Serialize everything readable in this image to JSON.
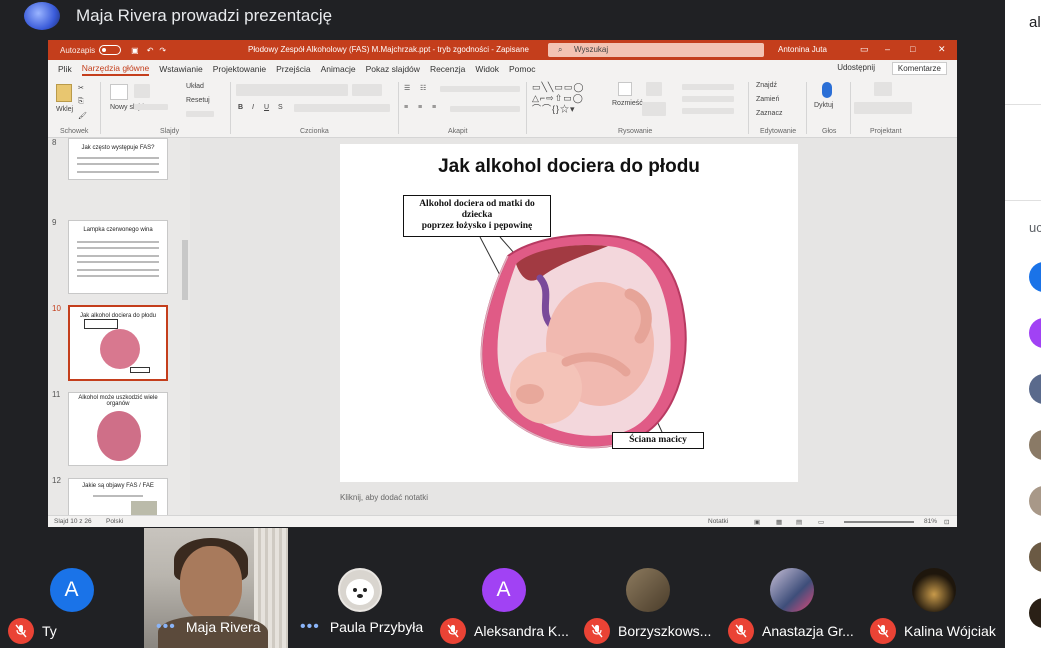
{
  "meet": {
    "presenter_title": "Maja Rivera prowadzi prezentację",
    "sidepanel": {
      "top_fragment": "al",
      "label_fragment": "uc"
    }
  },
  "ppt": {
    "autosave_label": "Autozapis",
    "filename": "Płodowy Zespół Alkoholowy (FAS) M.Majchrzak.ppt  -  tryb zgodności  -  Zapisane",
    "search_placeholder": "Wyszukaj",
    "user": "Antonina Juta",
    "menu": [
      "Plik",
      "Narzędzia główne",
      "Wstawianie",
      "Projektowanie",
      "Przejścia",
      "Animacje",
      "Pokaz slajdów",
      "Recenzja",
      "Widok",
      "Pomoc"
    ],
    "active_menu": "Narzędzia główne",
    "share_label": "Udostępnij",
    "comments_label": "Komentarze",
    "ribbon": {
      "paste": "Wklej",
      "new_slide": "Nowy slajd",
      "layout": "Układ",
      "reset": "Resetuj",
      "arrange": "Rozmieść",
      "find": "Znajdź",
      "replace": "Zamień",
      "select": "Zaznacz",
      "dictate": "Dyktuj",
      "groups": [
        "Schowek",
        "Slajdy",
        "Czcionka",
        "Akapit",
        "Rysowanie",
        "Edytowanie",
        "Głos",
        "Projektant"
      ]
    },
    "thumbnails": [
      {
        "num": "8",
        "title": "Jak często występuje FAS?"
      },
      {
        "num": "9",
        "title": "Lampka czerwonego wina"
      },
      {
        "num": "10",
        "title": "Jak alkohol dociera do płodu"
      },
      {
        "num": "11",
        "title": "Alkohol może uszkodzić wiele organów"
      },
      {
        "num": "12",
        "title": "Jakie są objawy FAS / FAE"
      }
    ],
    "slide": {
      "title": "Jak alkohol dociera do płodu",
      "callout_top": [
        "Alkohol dociera od matki do",
        "dziecka",
        "poprzez łożysko i pępowinę"
      ],
      "callout_bottom": "Ściana macicy"
    },
    "notes_placeholder": "Kliknij, aby dodać notatki",
    "status": {
      "slide_counter": "Slajd 10 z 26",
      "language": "Polski",
      "notes": "Notatki",
      "zoom": "81%"
    }
  },
  "participants": [
    {
      "name": "Ty",
      "initial": "",
      "color": "",
      "muted": true
    },
    {
      "name": "Maja Rivera",
      "initial": "",
      "color": "",
      "muted": false,
      "video": true
    },
    {
      "name": "Paula Przybyła",
      "initial": "",
      "color": "#ffffff",
      "muted": false
    },
    {
      "name": "Aleksandra K...",
      "initial": "A",
      "color": "#a142f4",
      "muted": true
    },
    {
      "name": "Borzyszkows...",
      "initial": "",
      "color": "#6b5a44",
      "muted": true
    },
    {
      "name": "Anastazja Gr...",
      "initial": "",
      "color": "#5a6a8c",
      "muted": true
    },
    {
      "name": "Kalina Wójciak",
      "initial": "",
      "color": "#2a2016",
      "muted": true
    }
  ],
  "self_tile_initial": "A",
  "self_tile_color": "#1a73e8",
  "colors": {
    "ppt_accent": "#c43e1c",
    "meet_bg": "#202124",
    "mute_red": "#ea4335"
  }
}
